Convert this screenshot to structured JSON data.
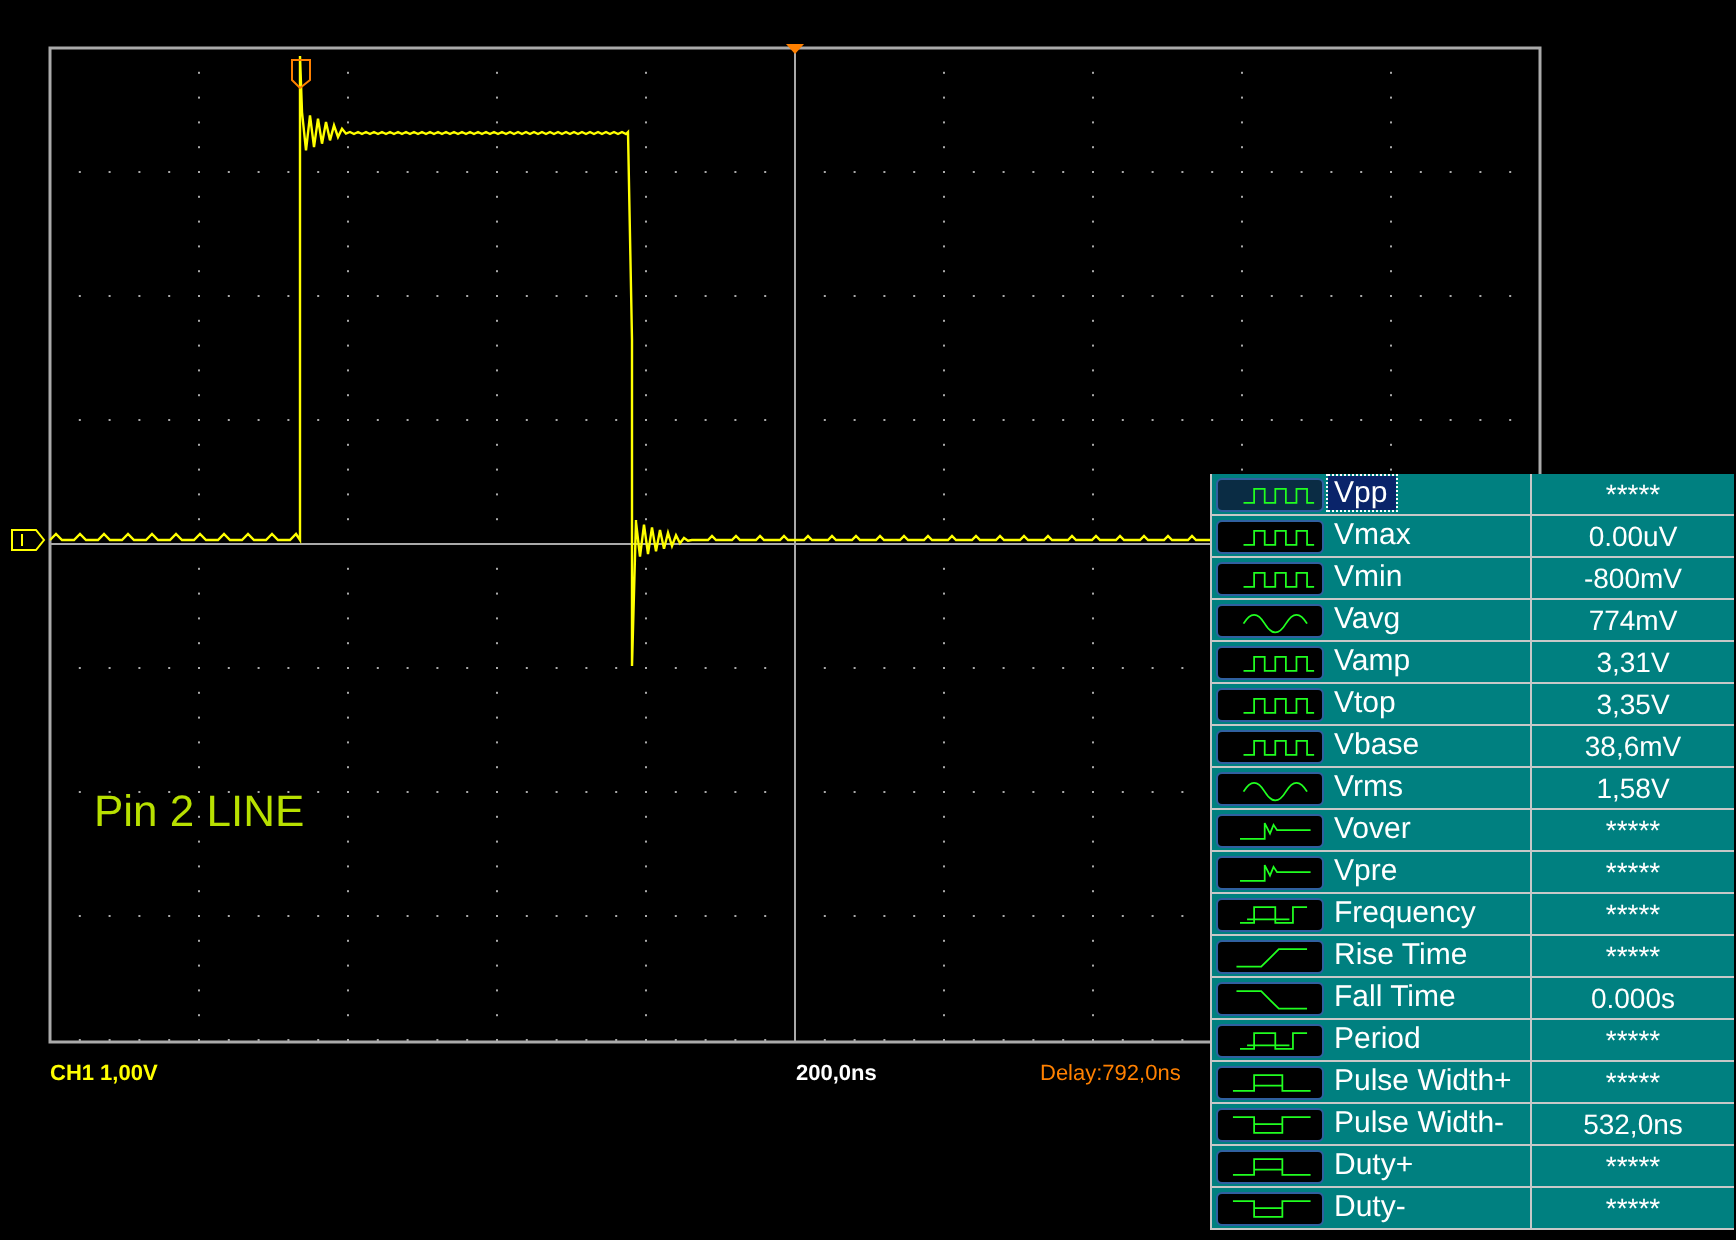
{
  "screen": {
    "label": "Pin 2 LINE"
  },
  "status_bar": {
    "channel": "CH1 1,00V",
    "timebase": "200,0ns",
    "delay": "Delay:792,0ns"
  },
  "measurements": [
    {
      "kind": "pulse-train",
      "name": "Vpp",
      "value": "*****",
      "selected": true
    },
    {
      "kind": "pulse-train",
      "name": "Vmax",
      "value": "0.00uV",
      "selected": false
    },
    {
      "kind": "pulse-train",
      "name": "Vmin",
      "value": "-800mV",
      "selected": false
    },
    {
      "kind": "sine",
      "name": "Vavg",
      "value": "774mV",
      "selected": false
    },
    {
      "kind": "pulse-train",
      "name": "Vamp",
      "value": "3,31V",
      "selected": false
    },
    {
      "kind": "pulse-train",
      "name": "Vtop",
      "value": "3,35V",
      "selected": false
    },
    {
      "kind": "pulse-train",
      "name": "Vbase",
      "value": "38,6mV",
      "selected": false
    },
    {
      "kind": "sine",
      "name": "Vrms",
      "value": "1,58V",
      "selected": false
    },
    {
      "kind": "overshoot",
      "name": "Vover",
      "value": "*****",
      "selected": false
    },
    {
      "kind": "overshoot",
      "name": "Vpre",
      "value": "*****",
      "selected": false
    },
    {
      "kind": "cycle",
      "name": "Frequency",
      "value": "*****",
      "selected": false
    },
    {
      "kind": "rise",
      "name": "Rise Time",
      "value": "*****",
      "selected": false
    },
    {
      "kind": "fall",
      "name": "Fall Time",
      "value": "0.000s",
      "selected": false
    },
    {
      "kind": "cycle",
      "name": "Period",
      "value": "*****",
      "selected": false
    },
    {
      "kind": "pulse-pos",
      "name": "Pulse Width+",
      "value": "*****",
      "selected": false
    },
    {
      "kind": "pulse-neg",
      "name": "Pulse Width-",
      "value": "532,0ns",
      "selected": false
    },
    {
      "kind": "pulse-pos",
      "name": "Duty+",
      "value": "*****",
      "selected": false
    },
    {
      "kind": "pulse-neg",
      "name": "Duty-",
      "value": "*****",
      "selected": false
    }
  ]
}
